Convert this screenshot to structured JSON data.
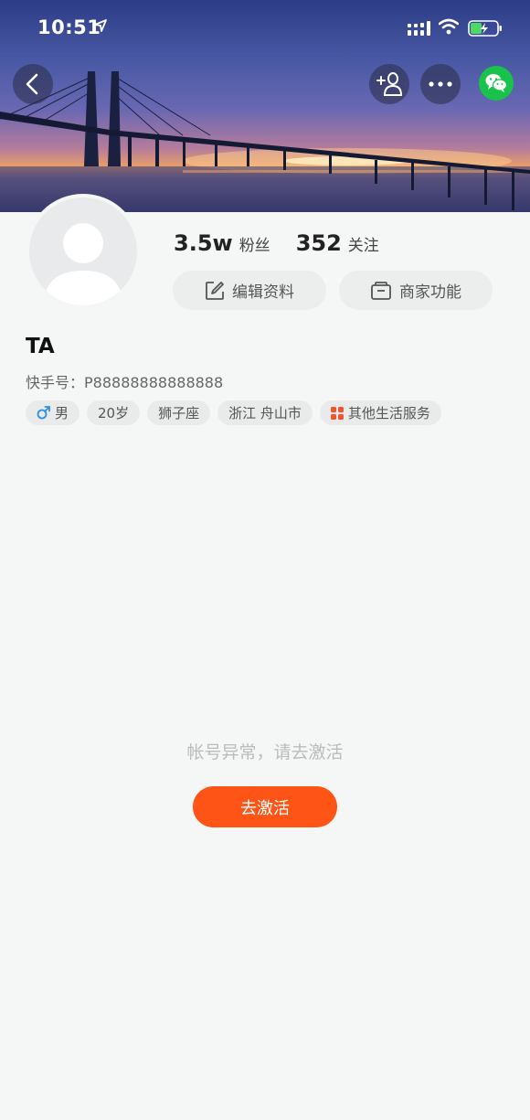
{
  "status_bar": {
    "time": "10:51"
  },
  "profile": {
    "followers": {
      "count": "3.5w",
      "label": "粉丝"
    },
    "following": {
      "count": "352",
      "label": "关注"
    },
    "edit_label": "编辑资料",
    "merchant_label": "商家功能",
    "name": "TA",
    "kuaishou_id": "快手号：P88888888888888",
    "tags": {
      "gender": "男",
      "age": "20岁",
      "zodiac": "狮子座",
      "location": "浙江 舟山市",
      "category": "其他生活服务"
    }
  },
  "empty_state": {
    "message": "帐号异常，请去激活",
    "button_label": "去激活"
  },
  "colors": {
    "accent": "#fe5415",
    "wechat": "#19c24a",
    "gender_male": "#2f8ee6",
    "category_icon": "#f2552c"
  },
  "icons": [
    "back-icon",
    "add-follow-icon",
    "more-icon",
    "wechat-icon",
    "edit-icon",
    "shop-icon",
    "male-icon",
    "category-grid-icon"
  ]
}
